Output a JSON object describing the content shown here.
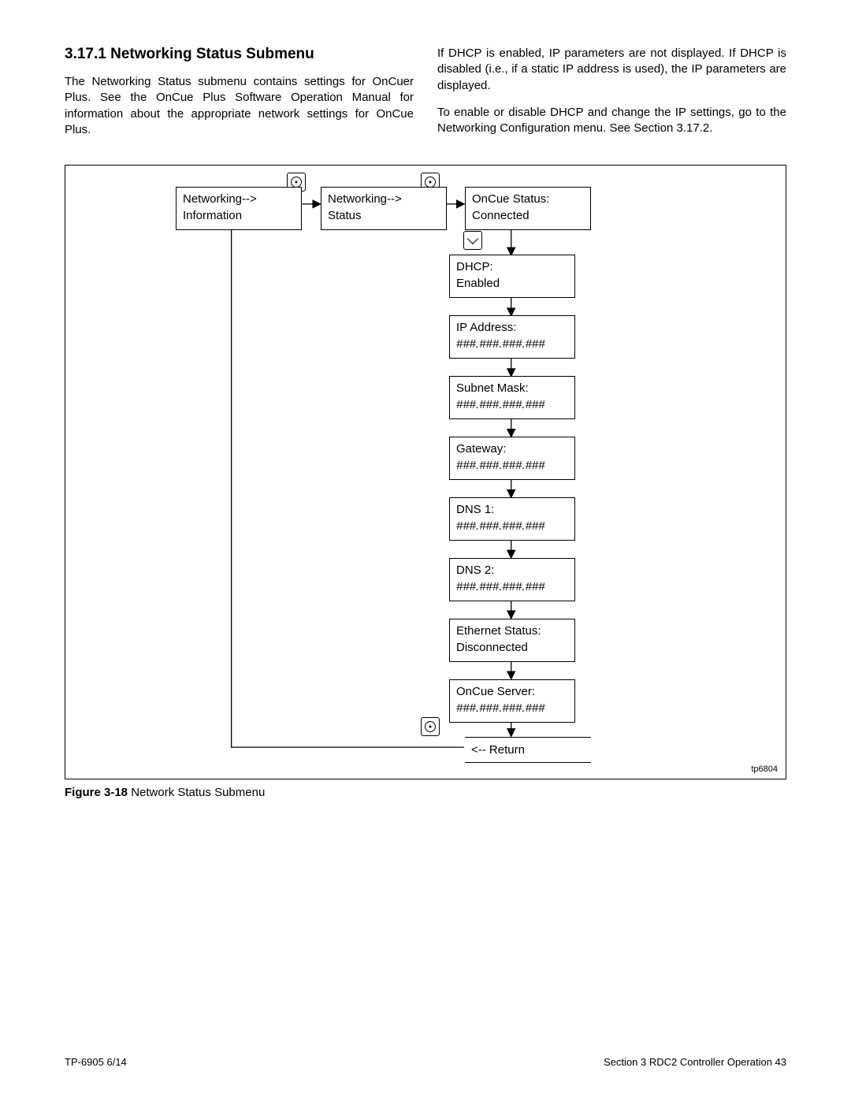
{
  "heading": "3.17.1  Networking Status Submenu",
  "para_left": "The Networking Status submenu contains settings for OnCuer Plus. See the OnCue Plus Software Operation Manual for information about the appropriate network settings for OnCue Plus.",
  "para_right_1": "If DHCP is enabled, IP parameters are not displayed. If DHCP is disabled (i.e., if a static IP address is used), the IP parameters are displayed.",
  "para_right_2": "To enable or disable DHCP and change the IP settings, go to the Networking Configuration menu. See Section 3.17.2.",
  "boxes": {
    "info": {
      "l1": "Networking-->",
      "l2": "Information"
    },
    "status": {
      "l1": "Networking-->",
      "l2": "Status"
    },
    "oncue": {
      "l1": "OnCue Status:",
      "l2": "Connected"
    },
    "dhcp": {
      "l1": "DHCP:",
      "l2": "Enabled"
    },
    "ip": {
      "l1": "IP Address:",
      "l2": "###.###.###.###"
    },
    "subnet": {
      "l1": "Subnet Mask:",
      "l2": "###.###.###.###"
    },
    "gw": {
      "l1": "Gateway:",
      "l2": "###.###.###.###"
    },
    "dns1": {
      "l1": "DNS 1:",
      "l2": "###.###.###.###"
    },
    "dns2": {
      "l1": "DNS 2:",
      "l2": "###.###.###.###"
    },
    "eth": {
      "l1": "Ethernet Status:",
      "l2": "Disconnected"
    },
    "srv": {
      "l1": "OnCue Server:",
      "l2": "###.###.###.###"
    }
  },
  "return_label": "<-- Return",
  "tp_label": "tp6804",
  "caption_bold": "Figure 3-18",
  "caption_rest": " Network Status Submenu",
  "footer_left": "TP-6905 6/14",
  "footer_right": "Section 3  RDC2 Controller Operation    43"
}
